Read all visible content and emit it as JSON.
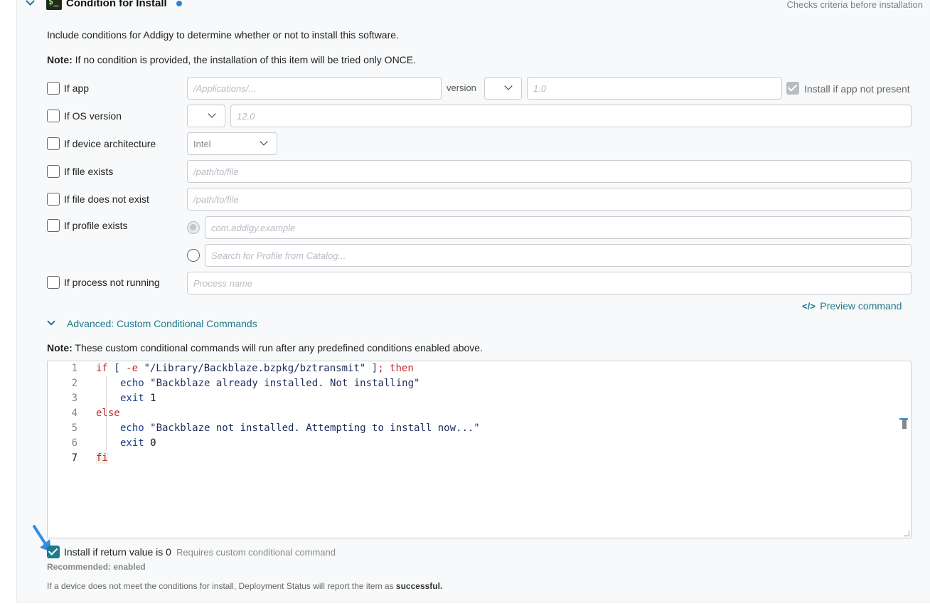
{
  "header": {
    "title": "Condition for Install",
    "subtitle": "Checks criteria before installation",
    "icon": "terminal-icon"
  },
  "intro": "Include conditions for Addigy to determine whether or not to install this software.",
  "note1": {
    "bold": "Note:",
    "text": " If no condition is provided, the installation of this item will be tried only ONCE."
  },
  "conditions": {
    "if_app": {
      "label": "If app",
      "path_placeholder": "/Applications/...",
      "version_label": "version",
      "version_placeholder": "1.0",
      "install_if_not_present": "Install if app not present"
    },
    "if_os": {
      "label": "If OS version",
      "placeholder": "12.0"
    },
    "if_arch": {
      "label": "If device architecture",
      "value": "Intel"
    },
    "if_file_exists": {
      "label": "If file exists",
      "placeholder": "/path/to/file"
    },
    "if_file_not_exist": {
      "label": "If file does not exist",
      "placeholder": "/path/to/file"
    },
    "if_profile": {
      "label": "If profile exists",
      "placeholder1": "com.addigy.example",
      "placeholder2": "Search for Profile from Catalog..."
    },
    "if_process": {
      "label": "If process not running",
      "placeholder": "Process name"
    }
  },
  "preview_command": "Preview command",
  "advanced_label": "Advanced: Custom Conditional Commands",
  "note2": {
    "bold": "Note:",
    "text": " These custom conditional commands will run after any predefined conditions enabled above."
  },
  "code_lines": [
    "1",
    "2",
    "3",
    "4",
    "5",
    "6",
    "7"
  ],
  "code": {
    "l1_if": "if",
    "l1_a": " [ ",
    "l1_flag": "-e",
    "l1_str": " \"/Library/Backblaze.bzpkg/bztransmit\" ",
    "l1_b": "]",
    "l1_then": "; then",
    "l2_echo": "echo",
    "l2_str": " \"Backblaze already installed. Not installing\"",
    "l3_exit": "exit",
    "l3_num": " 1",
    "l4_else": "else",
    "l5_echo": "echo",
    "l5_str": " \"Backblaze not installed. Attempting to install now...\"",
    "l6_exit": "exit",
    "l6_num": " 0",
    "l7_fi": "fi"
  },
  "return_check": {
    "label": "Install if return value is 0",
    "hint": "Requires custom conditional command",
    "checked": true
  },
  "recommended": "Recommended: enabled",
  "footer": {
    "text": "If a device does not meet the conditions for install, Deployment Status will report the item as ",
    "bold": "successful."
  },
  "colors": {
    "accent": "#1f7a8c",
    "arrow": "#2f8fe0"
  }
}
